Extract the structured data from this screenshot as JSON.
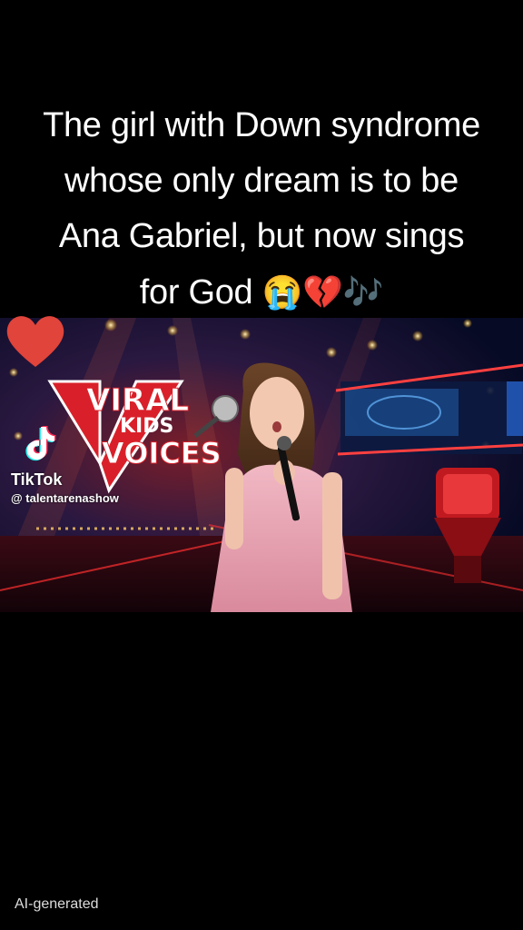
{
  "caption": {
    "line1": "The girl with Down syndrome",
    "line2": "whose only dream is to be",
    "line3": "Ana Gabriel, but now sings",
    "line4_text": "for God",
    "line4_emojis": "😭💔🎶"
  },
  "video": {
    "show_logo": {
      "line1": "VIRAL",
      "line2": "KIDS",
      "line3": "VOICES"
    },
    "watermark": {
      "app": "TikTok",
      "handle": "@ talentarenashow"
    }
  },
  "overlay": {
    "like_icon": "heart-icon"
  },
  "footer": {
    "ai_label": "AI-generated"
  },
  "colors": {
    "background": "#000000",
    "heart": "#e0443a",
    "logo_red": "#d9202a",
    "dress_pink": "#e8a7b4"
  }
}
